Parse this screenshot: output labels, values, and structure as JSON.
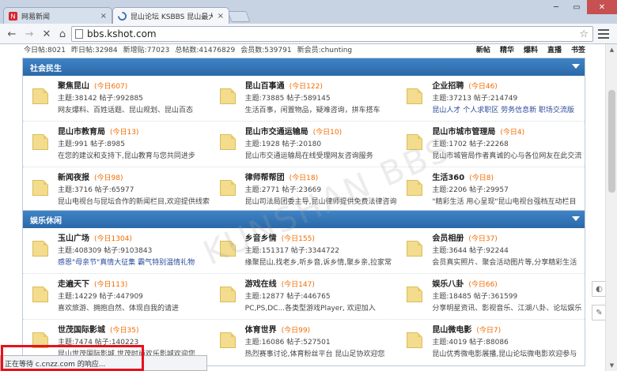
{
  "browser": {
    "tabs": [
      {
        "label": "网易新闻",
        "favicon": "netease-logo-icon"
      },
      {
        "label": "昆山论坛 KSBBS 昆山最大",
        "favicon": "loading-spinner-icon"
      }
    ],
    "url": "bbs.kshot.com",
    "status": "正在等待 c.cnzz.com 的响应...",
    "win_min": "─",
    "win_max": "▭",
    "win_close": "✕",
    "tab_close": "×"
  },
  "stats": {
    "today_label": "今日帖:",
    "today": "8021",
    "yesterday_label": "昨日帖:",
    "yesterday": "32984",
    "newest_label": "新增贴:",
    "newest": "77023",
    "total_label": "总帖数:",
    "total": "41476829",
    "members_label": "会员数:",
    "members": "539791",
    "newmember_label": "新会员:",
    "newmember": "chunting"
  },
  "quick_links": [
    "新帖",
    "精华",
    "爆料",
    "直播",
    "书签"
  ],
  "sections": [
    {
      "title": "社会民生",
      "rows": [
        [
          {
            "name": "聚焦昆山",
            "today": "(今日607)",
            "stats": "主题:38142  帖子:992885",
            "desc": "网友爆料、百姓话题、昆山规划、昆山百态",
            "desc_link": false
          },
          {
            "name": "昆山百事通",
            "today": "(今日122)",
            "stats": "主题:73885  帖子:589145",
            "desc": "生活百事，闲置物品，疑难咨询，拼车搭车",
            "desc_link": false
          },
          {
            "name": "企业招聘",
            "today": "(今日46)",
            "stats": "主题:37213  帖子:214749",
            "desc": "昆山人才  个人求职区  劳务信息新  职场交流版",
            "desc_link": true
          }
        ],
        [
          {
            "name": "昆山市教育局",
            "today": "(今日13)",
            "stats": "主题:991  帖子:8985",
            "desc": "在您的建议和支持下,昆山教育与您共同进步",
            "desc_link": false
          },
          {
            "name": "昆山市交通运输局",
            "today": "(今日10)",
            "stats": "主题:1928  帖子:20180",
            "desc": "昆山市交通运输局在线受理网友咨询服务",
            "desc_link": false
          },
          {
            "name": "昆山市城市管理局",
            "today": "(今日4)",
            "stats": "主题:1702  帖子:22268",
            "desc": "昆山市城管局作者真诚的心与各位网友在此交流",
            "desc_link": false
          }
        ],
        [
          {
            "name": "新闻夜报",
            "today": "(今日98)",
            "stats": "主题:3716  帖子:65977",
            "desc": "昆山电视台与昆坛合作的新闻栏目,欢迎提供线索",
            "desc_link": false
          },
          {
            "name": "律师帮帮团",
            "today": "(今日18)",
            "stats": "主题:2771  帖子:23669",
            "desc": "昆山司法局团委主导,昆山律师提供免费法律咨询",
            "desc_link": false
          },
          {
            "name": "生活360",
            "today": "(今日8)",
            "stats": "主题:2206  帖子:29957",
            "desc": "\"精彩生活 用心呈现\"昆山电视台强档互动栏目",
            "desc_link": false
          }
        ]
      ]
    },
    {
      "title": "娱乐休闲",
      "rows": [
        [
          {
            "name": "玉山广场",
            "today": "(今日1304)",
            "stats": "主题:408309  帖子:9103843",
            "desc": "感恩\"母亲节\"真情大征集 霸气特别温情礼物",
            "desc_link": true
          },
          {
            "name": "乡音乡情",
            "today": "(今日155)",
            "stats": "主题:151317  帖子:3344722",
            "desc": "缘聚昆山,找老乡,听乡音,诉乡情,聚乡亲,拉家常",
            "desc_link": false
          },
          {
            "name": "会员相册",
            "today": "(今日37)",
            "stats": "主题:3644  帖子:92244",
            "desc": "会员真实照片、聚会活动图片等,分享精彩生活",
            "desc_link": false
          }
        ],
        [
          {
            "name": "走遍天下",
            "today": "(今日113)",
            "stats": "主题:14229  帖子:447909",
            "desc": "喜欢旅游、拥抱自然、体现自我的请进",
            "desc_link": false
          },
          {
            "name": "游戏在线",
            "today": "(今日147)",
            "stats": "主题:12877  帖子:446765",
            "desc": "PC,PS,DC...各类型游戏Player, 欢迎加入",
            "desc_link": false
          },
          {
            "name": "娱乐八卦",
            "today": "(今日66)",
            "stats": "主题:18485  帖子:361599",
            "desc": "分享明星资讯、影视音乐、江湖八卦、论坛娱乐",
            "desc_link": false
          }
        ],
        [
          {
            "name": "世茂国际影城",
            "today": "(今日35)",
            "stats": "主题:7474  帖子:140223",
            "desc": "昆山世茂国际影城,世茂时尚欢乐影城欢迎您",
            "desc_link": false
          },
          {
            "name": "体育世界",
            "today": "(今日99)",
            "stats": "主题:16086  帖子:527501",
            "desc": "热烈赛事讨论,体育粉丝平台 昆山足协欢迎您",
            "desc_link": false
          },
          {
            "name": "昆山微电影",
            "today": "(今日7)",
            "stats": "主题:4019  帖子:88086",
            "desc": "昆山优秀微电影展播,昆山论坛微电影欢迎参与",
            "desc_link": false
          }
        ]
      ]
    }
  ],
  "watermark": "KUNSHAN BBS",
  "colors": {
    "header": "#2f73b6",
    "today": "#f26c00",
    "link": "#2b4b9c",
    "highlight": "#e8101c"
  }
}
